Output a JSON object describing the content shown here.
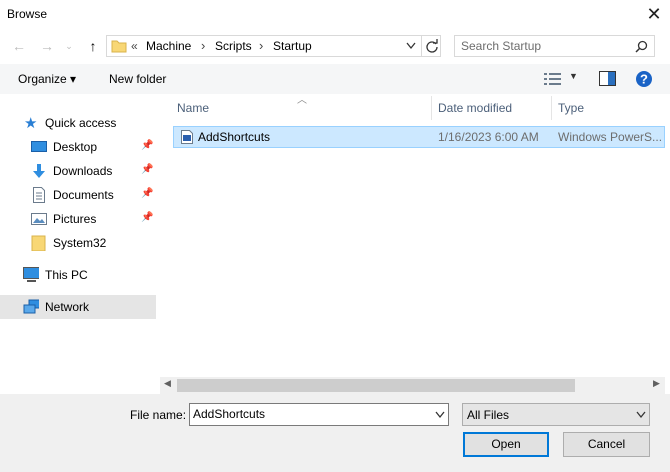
{
  "window": {
    "title": "Browse"
  },
  "address": {
    "overflow": "«",
    "crumbs": [
      "Machine",
      "Scripts",
      "Startup"
    ]
  },
  "search": {
    "placeholder": "Search Startup"
  },
  "toolbar": {
    "organize": "Organize ▾",
    "new_folder": "New folder"
  },
  "nav": {
    "quick_access": "Quick access",
    "items": [
      {
        "label": "Desktop",
        "pinned": true
      },
      {
        "label": "Downloads",
        "pinned": true
      },
      {
        "label": "Documents",
        "pinned": true
      },
      {
        "label": "Pictures",
        "pinned": true
      },
      {
        "label": "System32",
        "pinned": false
      }
    ],
    "this_pc": "This PC",
    "network": "Network"
  },
  "columns": {
    "name": "Name",
    "date": "Date modified",
    "type": "Type"
  },
  "files": [
    {
      "name": "AddShortcuts",
      "date": "1/16/2023 6:00 AM",
      "type": "Windows PowerS..."
    }
  ],
  "footer": {
    "file_name_label": "File name:",
    "file_name_value": "AddShortcuts",
    "file_type": "All Files",
    "open": "Open",
    "cancel": "Cancel"
  },
  "colors": {
    "selection": "#cce8ff",
    "accent": "#0078d7",
    "help": "#1a63c6"
  }
}
